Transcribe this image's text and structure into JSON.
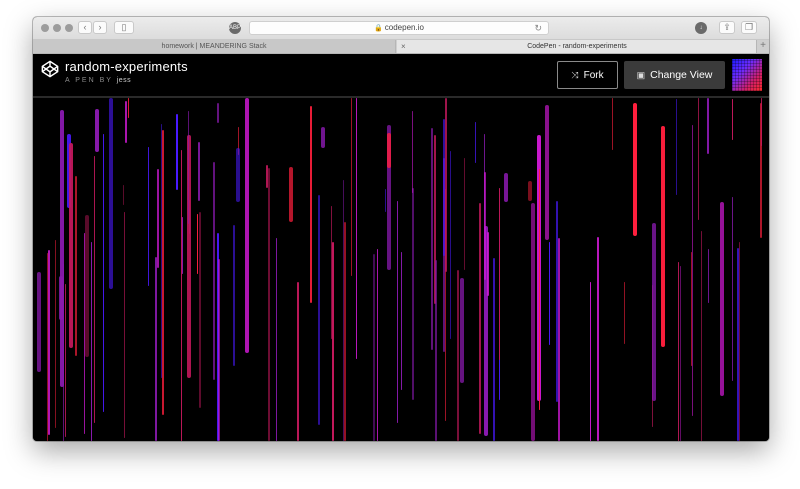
{
  "browser": {
    "address": "codepen.io",
    "tabs": [
      {
        "label": "homework | MEANDERING Stack"
      },
      {
        "label": "CodePen - random-experiments"
      }
    ],
    "tab_close_glyph": "×",
    "tab_add_glyph": "+"
  },
  "pen": {
    "title": "random-experiments",
    "byline_prefix": "A PEN BY",
    "author": "jess"
  },
  "actions": {
    "fork_label": "Fork",
    "change_view_label": "Change View"
  },
  "icons": [
    "codepen-logo-icon",
    "fork-icon",
    "change-view-icon",
    "lock-icon",
    "reload-icon",
    "sidebar-icon",
    "back-icon",
    "forward-icon",
    "download-icon",
    "share-icon",
    "tabs-icon"
  ],
  "colors": {
    "accent_red": "#ff1f3d",
    "accent_magenta": "#d41ad9",
    "accent_blue": "#4a1aff",
    "accent_purple": "#8a1ab0",
    "accent_crimson": "#c2185b"
  }
}
